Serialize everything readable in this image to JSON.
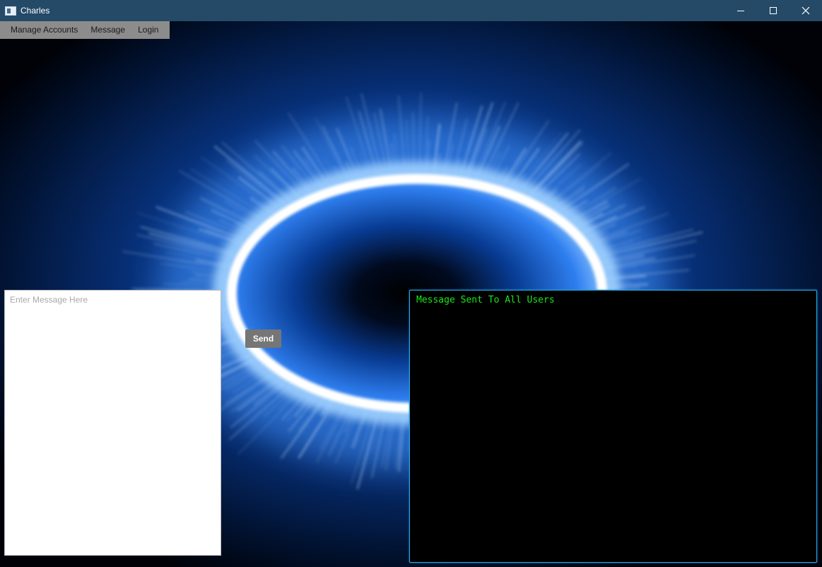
{
  "window": {
    "title": "Charles"
  },
  "menu": {
    "items": [
      "Manage Accounts",
      "Message",
      "Login"
    ]
  },
  "message_input": {
    "value": "",
    "placeholder": "Enter Message Here"
  },
  "send_button": {
    "label": "Send"
  },
  "console": {
    "lines": [
      "Message Sent To All Users"
    ]
  },
  "colors": {
    "titlebar": "#254a68",
    "menubar": "#8c8c8c",
    "console_text": "#19e819",
    "console_border": "#2aa7e0",
    "send_button": "#767676"
  },
  "icons": {
    "app": "app-window-icon",
    "minimize": "minimize-icon",
    "maximize": "maximize-icon",
    "close": "close-icon"
  }
}
